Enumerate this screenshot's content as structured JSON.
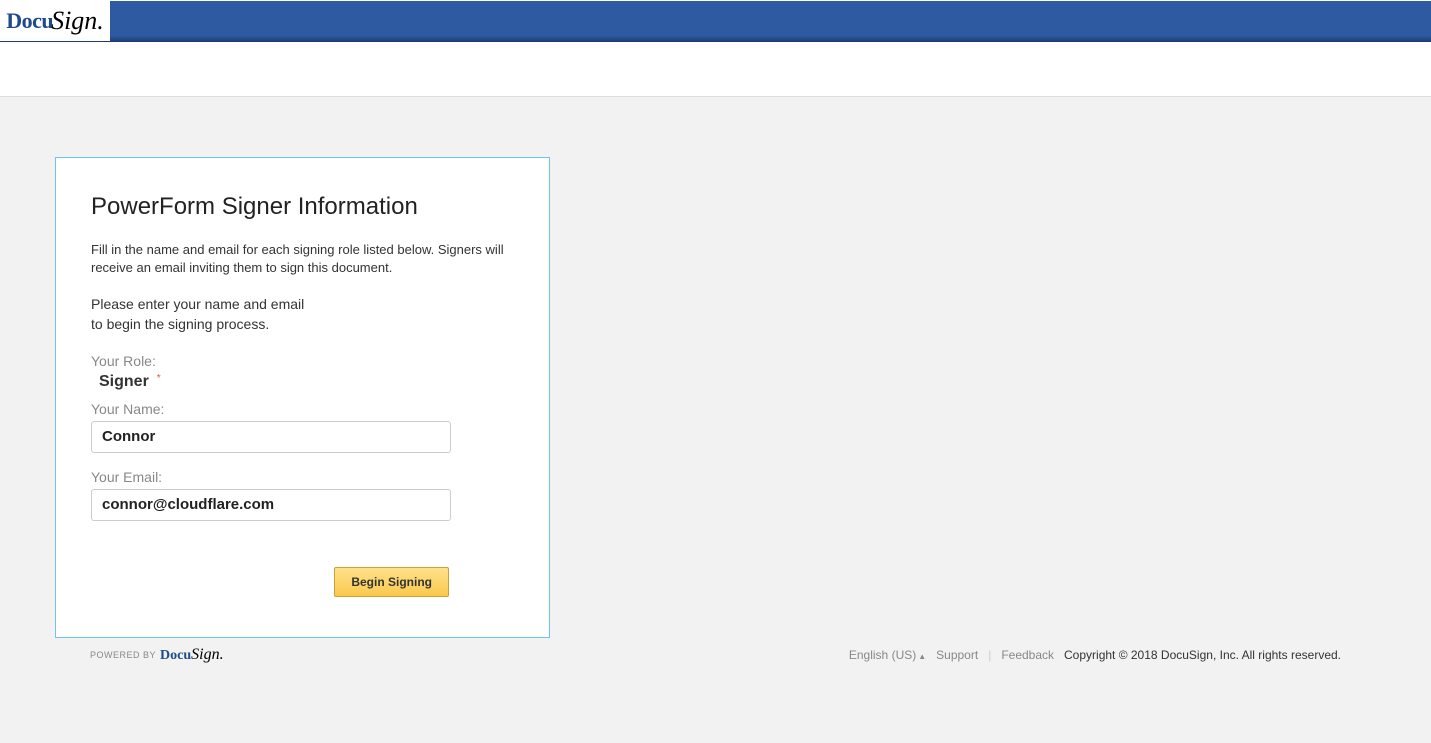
{
  "brand": {
    "docu": "Docu",
    "sign": "Sign."
  },
  "form": {
    "title": "PowerForm Signer Information",
    "description": "Fill in the name and email for each signing role listed below. Signers will receive an email inviting them to sign this document.",
    "instruction": "Please enter your name and email\nto begin the signing process.",
    "roleLabel": "Your Role:",
    "roleValue": "Signer",
    "nameLabel": "Your Name:",
    "nameValue": "Connor",
    "emailLabel": "Your Email:",
    "emailValue": "connor@cloudflare.com",
    "submitLabel": "Begin Signing"
  },
  "footer": {
    "poweredBy": "POWERED BY",
    "language": "English (US)",
    "support": "Support",
    "feedback": "Feedback",
    "copyright": "Copyright © 2018 DocuSign, Inc. All rights reserved."
  }
}
